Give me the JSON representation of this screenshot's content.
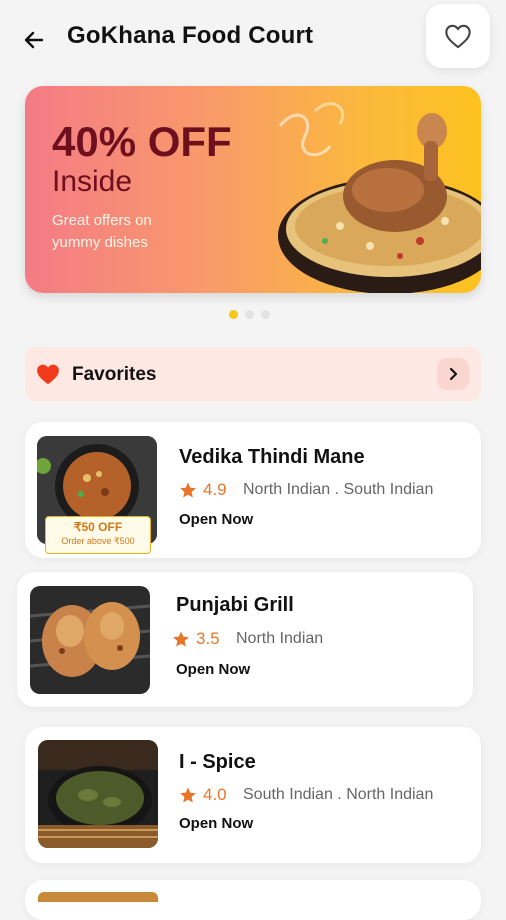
{
  "header": {
    "title": "GoKhana Food Court",
    "back_icon": "arrow-left-icon",
    "favorite_icon": "heart-outline-icon"
  },
  "banner": {
    "headline": "40% OFF",
    "subheadline": "Inside",
    "description": "Great offers on yummy dishes",
    "colors": [
      "#f47b86",
      "#fdc21f"
    ],
    "headline_color": "#6e0f1e"
  },
  "carousel": {
    "total": 3,
    "active_index": 0
  },
  "favorites": {
    "label": "Favorites",
    "icon": "heart-filled-icon",
    "chevron_icon": "chevron-right-icon"
  },
  "restaurants": [
    {
      "name": "Vedika Thindi Mane",
      "rating": "4.9",
      "cuisines": "North Indian . South Indian",
      "status": "Open Now",
      "offer": {
        "main": "₹50 OFF",
        "sub": "Order above ₹500"
      }
    },
    {
      "name": "Punjabi Grill",
      "rating": "3.5",
      "cuisines": "North Indian",
      "status": "Open Now"
    },
    {
      "name": "I - Spice",
      "rating": "4.0",
      "cuisines": "South Indian . North Indian",
      "status": "Open Now"
    }
  ],
  "colors": {
    "accent_orange": "#e8762a",
    "favorites_bg": "#fde8e4",
    "heart_red": "#f23a1c",
    "dot_active": "#f7c619"
  }
}
